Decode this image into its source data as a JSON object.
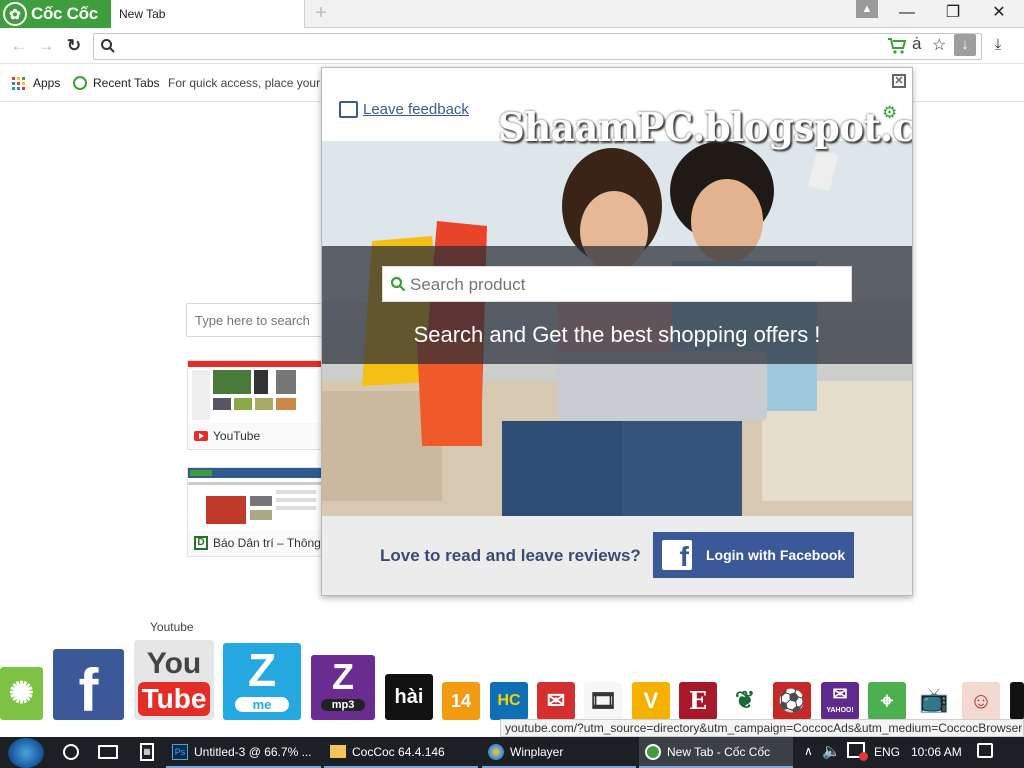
{
  "browser": {
    "brand_name": "Cốc Cốc",
    "tab_title": "New Tab",
    "new_tab_symbol": "+",
    "window_controls": {
      "minimize": "—",
      "maximize": "❐",
      "close": "✕"
    }
  },
  "toolbar": {
    "omnibox_value": "",
    "icons": [
      "back-arrow-icon",
      "forward-arrow-icon",
      "reload-icon",
      "search-icon",
      "shopping-cart-icon",
      "transliteration-icon",
      "star-icon",
      "savefrom-download-icon",
      "download-icon"
    ]
  },
  "bookmarks": {
    "apps_label": "Apps",
    "recent_tabs_label": "Recent Tabs",
    "hint": "For quick access, place your b"
  },
  "page": {
    "search_placeholder": "Type here to search",
    "tiles": [
      {
        "label": "YouTube",
        "favicon": "youtube-icon"
      },
      {
        "label": "Báo Dân trí – Thông",
        "favicon": "dantri-icon"
      }
    ]
  },
  "popup": {
    "feedback_label": "Leave feedback",
    "watermark": "ShaamPC.blogspot.com",
    "search_placeholder": "Search product",
    "headline": "Search and Get the best shopping offers !",
    "reviews_prompt": "Love to read and leave reviews?",
    "facebook_button": "Login with Facebook",
    "colors": {
      "facebook": "#3b5998",
      "accent": "#3e9d3c"
    }
  },
  "dock": {
    "tooltip": "Youtube",
    "youtube_text": [
      "You",
      "Tube"
    ],
    "zing_me": "me",
    "zing_mp3": "mp3",
    "hai": "hài",
    "kenh14": "14",
    "hc": "HC",
    "yahoo": "YAHOO!",
    "e_letter": "E",
    "status_url": "youtube.com/?utm_source=directory&utm_campaign=CoccocAds&utm_medium=CoccocBrowser"
  },
  "taskbar": {
    "items": [
      {
        "label": "Untitled-3 @ 66.7% ...",
        "app": "photoshop-icon"
      },
      {
        "label": "CocCoc 64.4.146",
        "app": "folder-icon"
      },
      {
        "label": "Winplayer",
        "app": "winplayer-icon"
      },
      {
        "label": "New Tab - Cốc Cốc",
        "app": "coccoc-icon"
      }
    ],
    "language": "ENG",
    "time": "10:06 AM"
  }
}
